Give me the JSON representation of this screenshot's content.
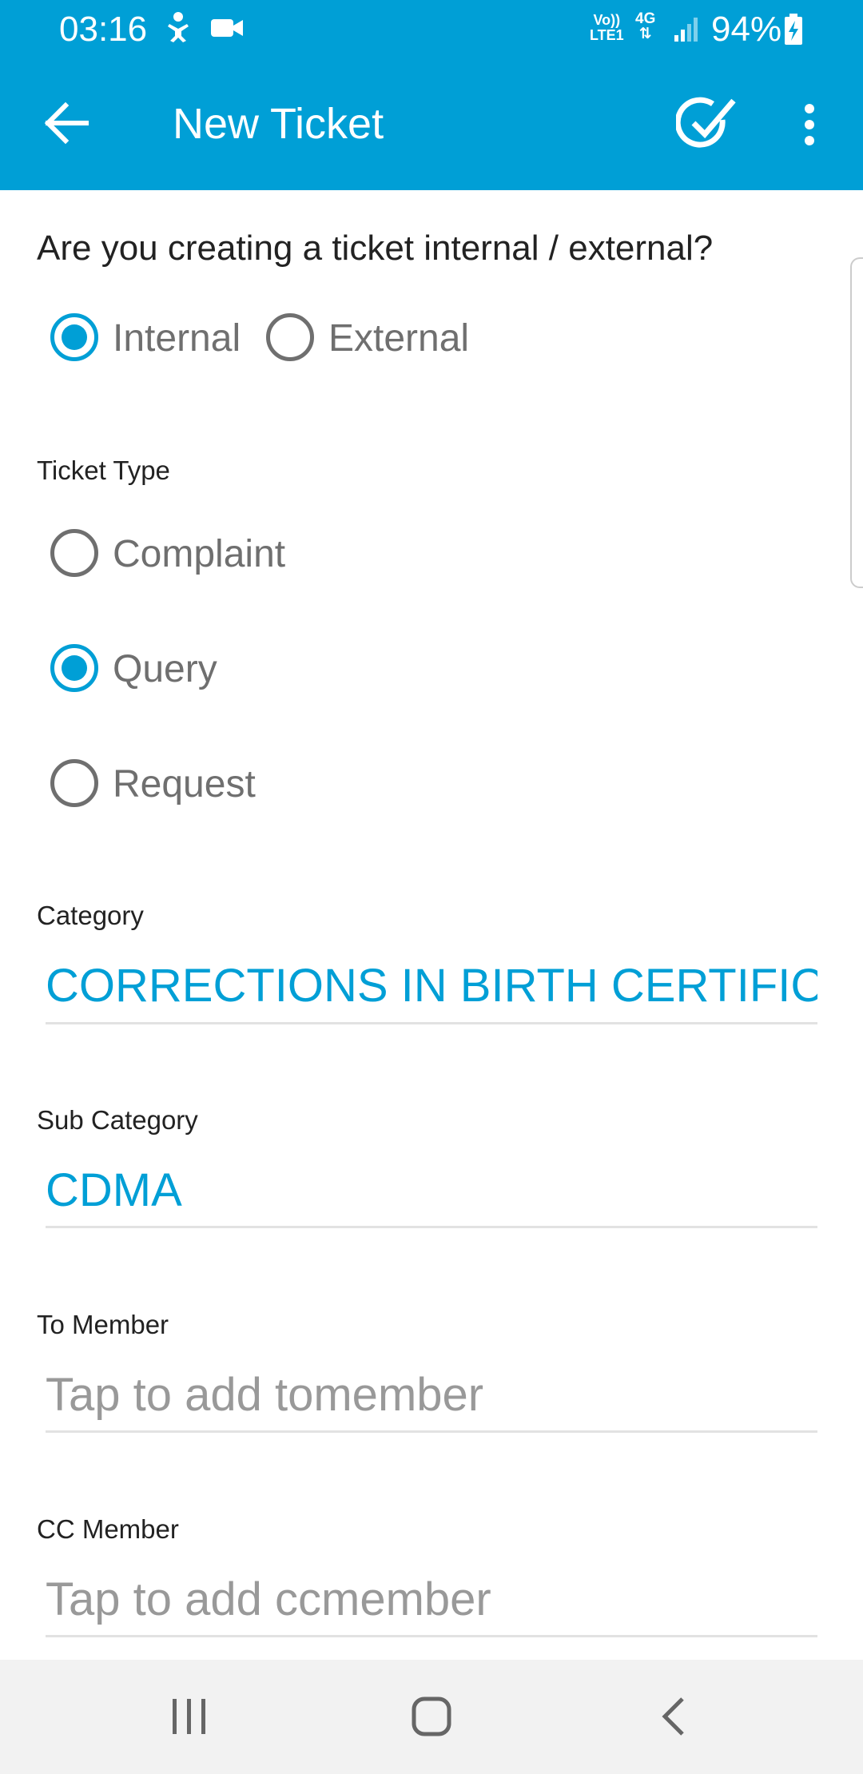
{
  "status_bar": {
    "time": "03:16",
    "network_top": "Vo))",
    "network_bottom": "LTE1",
    "network_type": "4G",
    "battery": "94%",
    "icons": [
      "accessibility-icon",
      "video-icon",
      "signal-icon",
      "battery-charging-icon"
    ]
  },
  "toolbar": {
    "title": "New Ticket",
    "back_icon": "arrow-left-icon",
    "done_icon": "check-circle-icon",
    "more_icon": "more-vert-icon"
  },
  "form": {
    "question": "Are you creating a ticket internal / external?",
    "scope_options": [
      {
        "label": "Internal",
        "checked": true
      },
      {
        "label": "External",
        "checked": false
      }
    ],
    "ticket_type_label": "Ticket Type",
    "ticket_types": [
      {
        "label": "Complaint",
        "checked": false
      },
      {
        "label": "Query",
        "checked": true
      },
      {
        "label": "Request",
        "checked": false
      }
    ],
    "category": {
      "label": "Category",
      "value": "CORRECTIONS IN BIRTH CERTIFICATE"
    },
    "sub_category": {
      "label": "Sub Category",
      "value": "CDMA"
    },
    "to_member": {
      "label": "To Member",
      "placeholder": "Tap to add tomember"
    },
    "cc_member": {
      "label": "CC Member",
      "placeholder": "Tap to add ccmember"
    }
  },
  "nav_bar": {
    "icons": [
      "recents-icon",
      "home-icon",
      "back-icon"
    ]
  },
  "colors": {
    "accent": "#009fd6",
    "radio_unchecked": "#6f6f6f",
    "hint_text": "#999999",
    "nav_background": "#f2f2f2"
  }
}
